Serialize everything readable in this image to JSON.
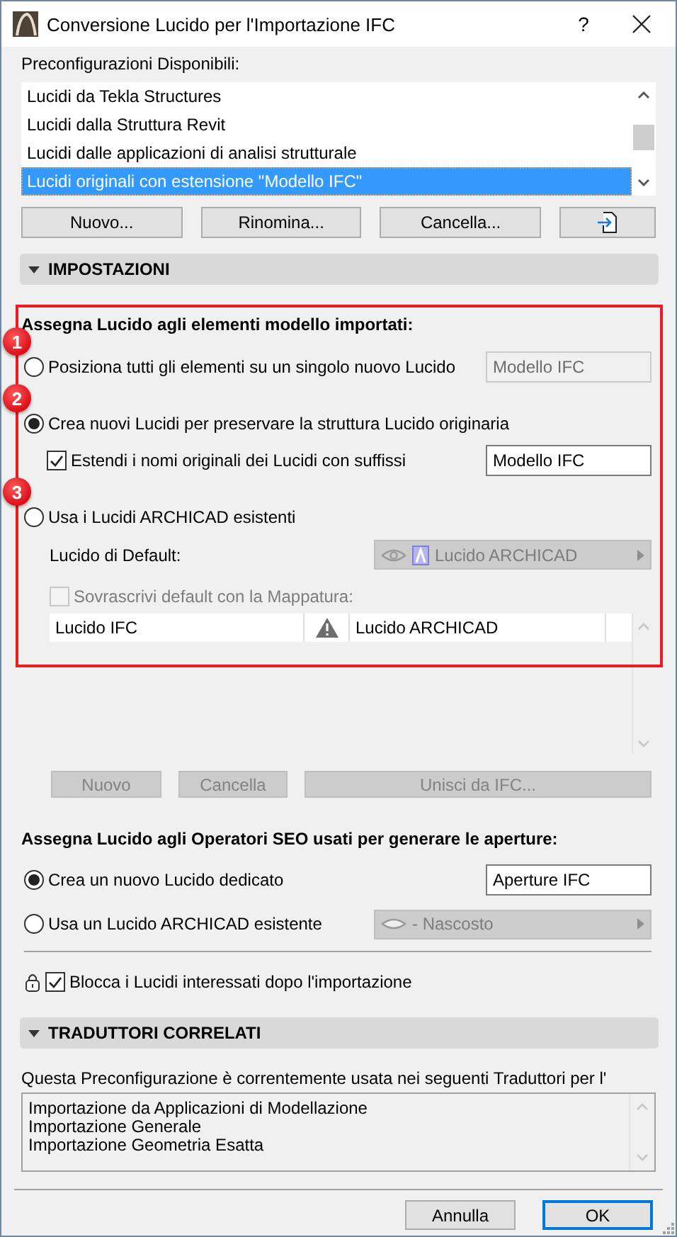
{
  "window": {
    "title": "Conversione Lucido per l'Importazione IFC",
    "help": "?"
  },
  "presets": {
    "label": "Preconfigurazioni Disponibili:",
    "items": [
      {
        "label": "Lucidi da Tekla Structures",
        "selected": false
      },
      {
        "label": "Lucidi dalla Struttura Revit",
        "selected": false
      },
      {
        "label": "Lucidi dalle applicazioni di analisi strutturale",
        "selected": false
      },
      {
        "label": "Lucidi originali con estensione \"Modello IFC\"",
        "selected": true
      }
    ],
    "buttons": [
      {
        "kind": "text",
        "label": "Nuovo..."
      },
      {
        "kind": "text",
        "label": "Rinomina..."
      },
      {
        "kind": "text",
        "label": "Cancella..."
      },
      {
        "kind": "import"
      }
    ]
  },
  "settings": {
    "title": "IMPOSTAZIONI",
    "expanded": true
  },
  "import_layers": {
    "heading": "Assegna Lucido agli elementi modello importati:",
    "options": [
      {
        "marker": "1",
        "label": "Posiziona tutti gli elementi su un singolo nuovo Lucido",
        "selected": false,
        "field": {
          "value": "Modello IFC",
          "disabled": true
        }
      },
      {
        "marker": "2",
        "label": "Crea nuovi Lucidi per preservare la struttura Lucido originaria",
        "selected": true,
        "suffix": {
          "label": "Estendi i nomi originali dei Lucidi con suffissi",
          "checked": true,
          "value": "Modello IFC"
        }
      },
      {
        "marker": "3",
        "label": "Usa i Lucidi ARCHICAD esistenti",
        "selected": false
      }
    ],
    "default_layer": {
      "label": "Lucido di Default:",
      "value": "Lucido ARCHICAD",
      "visible": true,
      "disabled": true
    },
    "override": {
      "label": "Sovrascrivi default con la Mappatura:",
      "checked": false,
      "disabled": true
    },
    "mapping_rows": [
      {
        "ifc_layer": "Lucido IFC",
        "warning": true,
        "archicad_layer": "Lucido ARCHICAD"
      }
    ],
    "buttons": [
      {
        "label": "Nuovo",
        "disabled": true
      },
      {
        "label": "Cancella",
        "disabled": true
      },
      {
        "label": "Unisci da IFC...",
        "disabled": true
      }
    ]
  },
  "openings": {
    "heading": "Assegna Lucido agli Operatori SEO usati per generare le aperture:",
    "options": [
      {
        "kind": "field",
        "label": "Crea un nuovo Lucido dedicato",
        "selected": true,
        "value": "Aperture IFC"
      },
      {
        "kind": "dropdown",
        "label": "Usa un Lucido ARCHICAD esistente",
        "selected": false,
        "value": "- Nascosto",
        "visible": false,
        "disabled": true
      }
    ]
  },
  "lock": {
    "label": "Blocca i Lucidi interessati dopo l'importazione",
    "checked": true
  },
  "translators": {
    "title": "TRADUTTORI CORRELATI",
    "expanded": true,
    "note": "Questa Preconfigurazione è correntemente usata nei seguenti Traduttori per l'",
    "items": [
      "Importazione da Applicazioni di Modellazione",
      "Importazione Generale",
      "Importazione Geometria Esatta"
    ]
  },
  "footer": {
    "buttons": [
      {
        "label": "Annulla",
        "default": false
      },
      {
        "label": "OK",
        "default": true
      }
    ]
  }
}
